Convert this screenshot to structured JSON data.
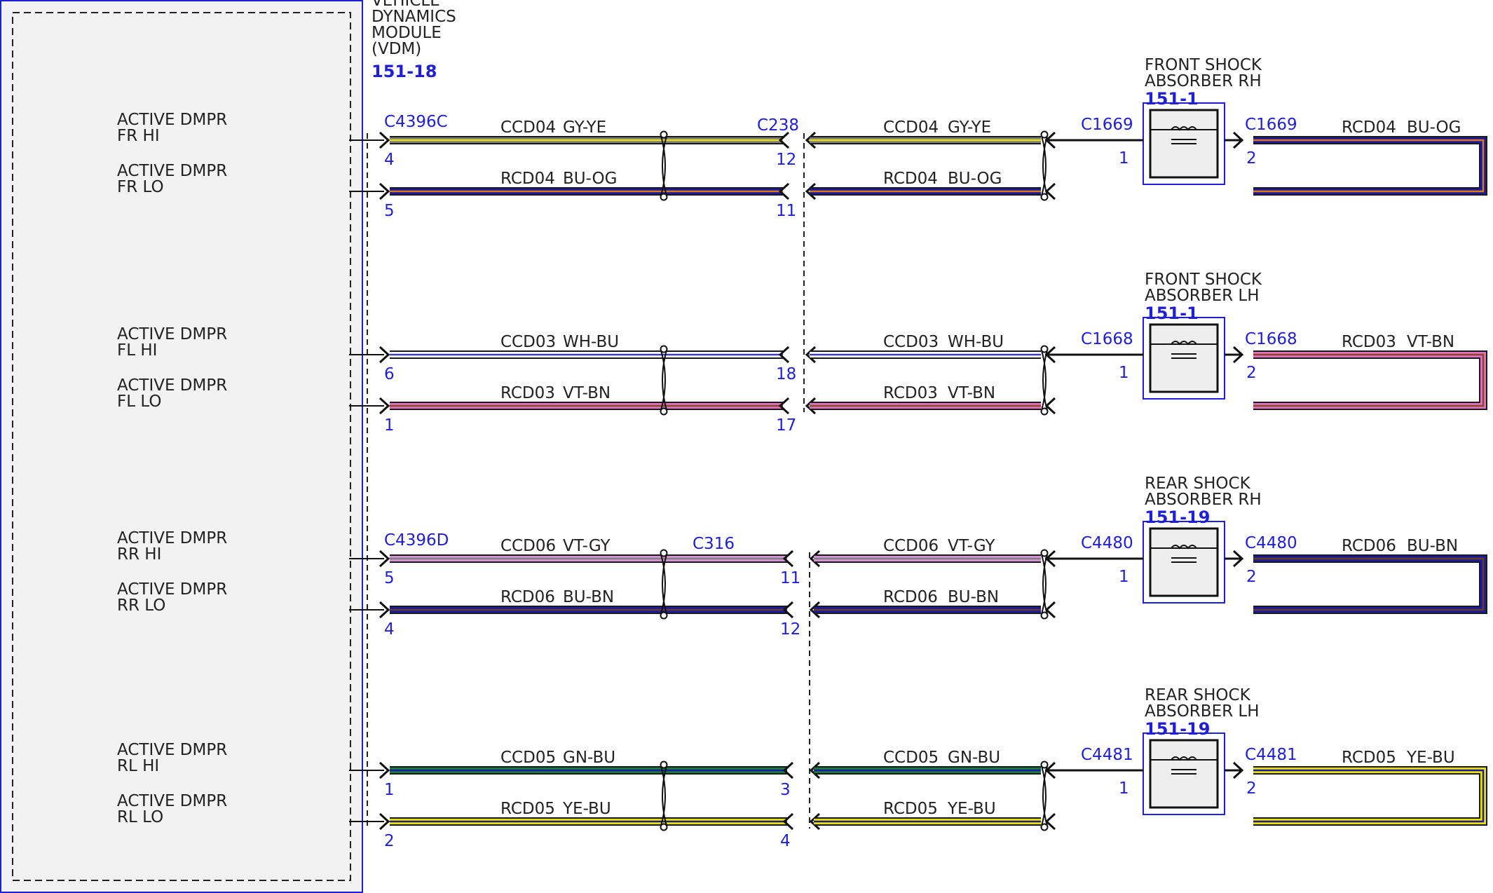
{
  "colors": {
    "text": "#222222",
    "connector_blue": "#1f1fd6",
    "module_fill": "#f2f2f2",
    "GY-YE": [
      "#808080",
      "#e8e000"
    ],
    "BU-OG": [
      "#1a1aa8",
      "#e07a00"
    ],
    "WH-BU": [
      "#ffffff",
      "#3a3ad0"
    ],
    "VT-BN": [
      "#e070c8",
      "#8a4a1c"
    ],
    "VT-GY": [
      "#d890d8",
      "#808080"
    ],
    "BU-BN": [
      "#1a1aa8",
      "#6b3d12"
    ],
    "GN-BU": [
      "#157a3a",
      "#1a1aa8"
    ],
    "YE-BU": [
      "#e8e000",
      "#1a1aa8"
    ]
  },
  "module": {
    "name_lines": [
      "VEHICLE",
      "DYNAMICS",
      "MODULE",
      "(VDM)"
    ],
    "ref": "151-18"
  },
  "groups": [
    {
      "id": "fr",
      "module_connector": "C4396C",
      "inline_connector": "C238",
      "device_lines": [
        "FRONT SHOCK",
        "ABSORBER RH"
      ],
      "device_ref": "151-1",
      "device_connector": "C1669",
      "circuits": [
        {
          "pin_label": [
            "ACTIVE DMPR",
            "FR HI"
          ],
          "circuit": "CCD04",
          "color": "GY-YE",
          "module_pin": "4",
          "inline_pin": "12",
          "device_pin": "1"
        },
        {
          "pin_label": [
            "ACTIVE DMPR",
            "FR LO"
          ],
          "circuit": "RCD04",
          "color": "BU-OG",
          "module_pin": "5",
          "inline_pin": "11",
          "device_pin": "2"
        }
      ]
    },
    {
      "id": "fl",
      "module_connector": "",
      "inline_connector": "",
      "device_lines": [
        "FRONT SHOCK",
        "ABSORBER LH"
      ],
      "device_ref": "151-1",
      "device_connector": "C1668",
      "circuits": [
        {
          "pin_label": [
            "ACTIVE DMPR",
            "FL HI"
          ],
          "circuit": "CCD03",
          "color": "WH-BU",
          "module_pin": "6",
          "inline_pin": "18",
          "device_pin": "1"
        },
        {
          "pin_label": [
            "ACTIVE DMPR",
            "FL LO"
          ],
          "circuit": "RCD03",
          "color": "VT-BN",
          "module_pin": "1",
          "inline_pin": "17",
          "device_pin": "2"
        }
      ]
    },
    {
      "id": "rr",
      "module_connector": "C4396D",
      "inline_connector": "C316",
      "device_lines": [
        "REAR SHOCK",
        "ABSORBER RH"
      ],
      "device_ref": "151-19",
      "device_connector": "C4480",
      "circuits": [
        {
          "pin_label": [
            "ACTIVE DMPR",
            "RR HI"
          ],
          "circuit": "CCD06",
          "color": "VT-GY",
          "module_pin": "5",
          "inline_pin": "11",
          "device_pin": "1"
        },
        {
          "pin_label": [
            "ACTIVE DMPR",
            "RR LO"
          ],
          "circuit": "RCD06",
          "color": "BU-BN",
          "module_pin": "4",
          "inline_pin": "12",
          "device_pin": "2"
        }
      ]
    },
    {
      "id": "rl",
      "module_connector": "",
      "inline_connector": "",
      "device_lines": [
        "REAR SHOCK",
        "ABSORBER LH"
      ],
      "device_ref": "151-19",
      "device_connector": "C4481",
      "circuits": [
        {
          "pin_label": [
            "ACTIVE DMPR",
            "RL HI"
          ],
          "circuit": "CCD05",
          "color": "GN-BU",
          "module_pin": "1",
          "inline_pin": "3",
          "device_pin": "1"
        },
        {
          "pin_label": [
            "ACTIVE DMPR",
            "RL LO"
          ],
          "circuit": "RCD05",
          "color": "YE-BU",
          "module_pin": "2",
          "inline_pin": "4",
          "device_pin": "2"
        }
      ]
    }
  ]
}
